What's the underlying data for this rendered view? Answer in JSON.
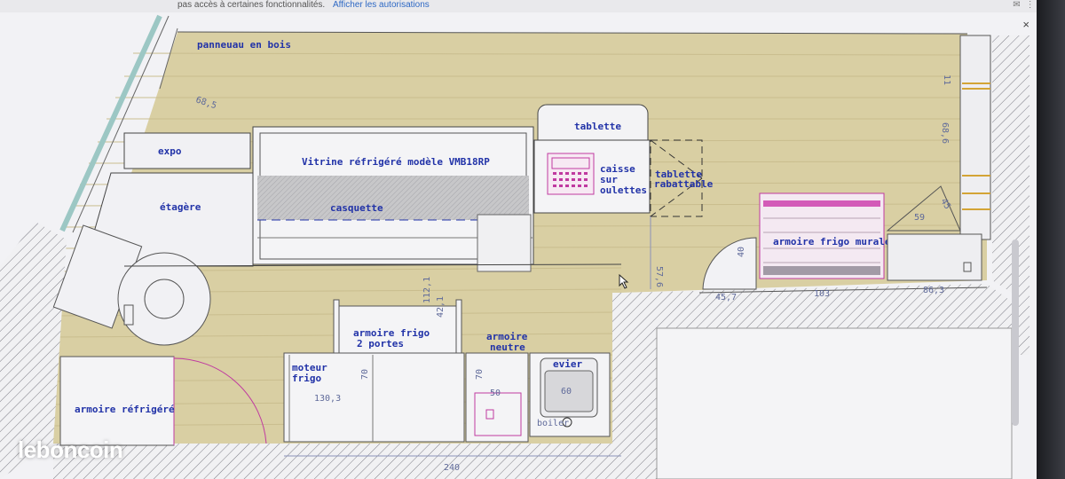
{
  "browser": {
    "notice_text": "pas accès à certaines fonctionnalités.",
    "notice_link": "Afficher les autorisations",
    "close_glyph": "×"
  },
  "plan": {
    "labels": {
      "panneau": "panneuau en bois",
      "expo": "expo",
      "etagere": "étagère",
      "vitrine": "Vitrine réfrigéré modèle VMB18RP",
      "casquette": "casquette",
      "tablette": "tablette",
      "caisse_1": "caisse",
      "caisse_2": "sur",
      "caisse_3": "oulettes",
      "rabattable_1": "tablette",
      "rabattable_2": "rabattable",
      "armoire_murale": "armoire frigo murale",
      "armoire_2p_1": "armoire frigo",
      "armoire_2p_2": "2 portes",
      "armoire_neutre_1": "armoire",
      "armoire_neutre_2": "neutre",
      "evier": "evier",
      "moteur_1": "moteur",
      "moteur_2": "frigo",
      "armoire_refrigere": "armoire réfrigéré",
      "boiler": "boiler"
    },
    "dimensions": {
      "d68_5": "68,5",
      "d11": "11",
      "d68_6": "68,6",
      "d45": "45",
      "d59": "59",
      "d57_6": "57,6",
      "d40": "40",
      "d45_7": "45,7",
      "d103": "103",
      "d86_3": "86,3",
      "d112_1": "112,1",
      "d42_1": "42,1",
      "d70a": "70",
      "d70b": "70",
      "d130_3": "130,3",
      "d50": "50",
      "d60": "60",
      "d240": "240"
    }
  },
  "watermark": "leboncoin"
}
